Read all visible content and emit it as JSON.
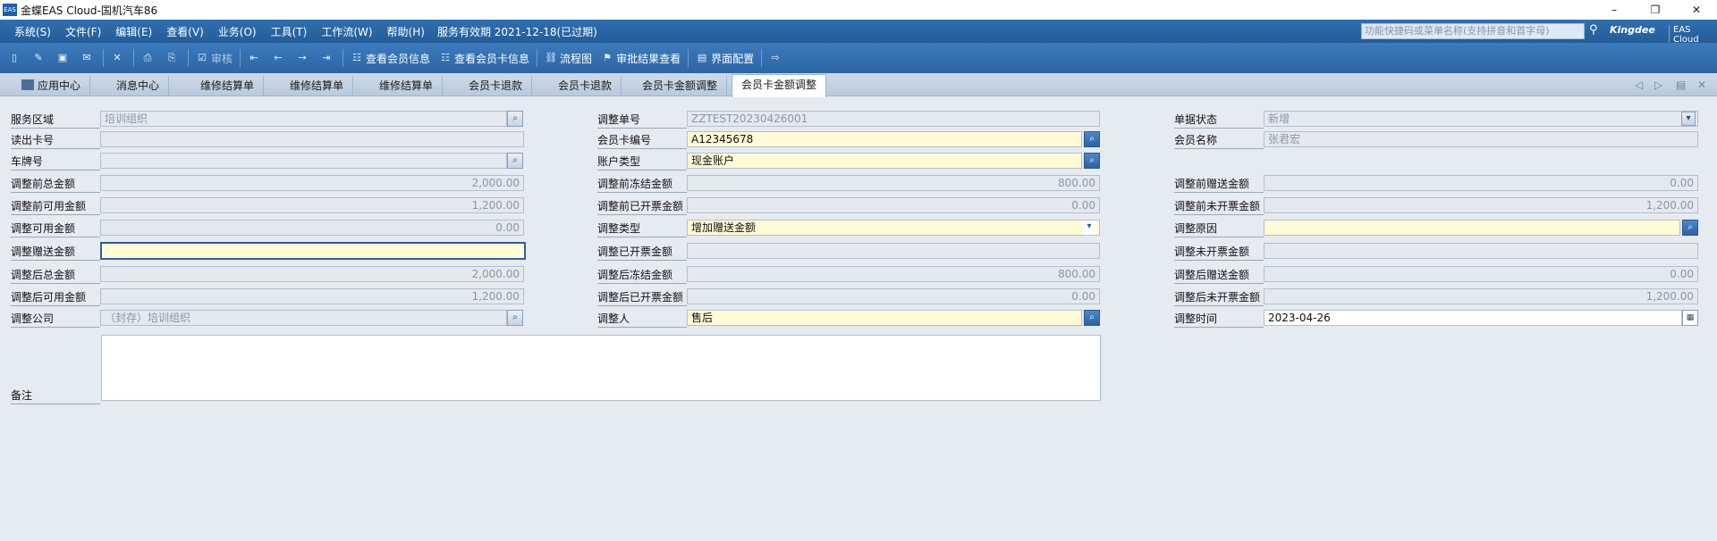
{
  "window": {
    "app_icon_text": "EAS",
    "title": "金蝶EAS Cloud-国机汽车86",
    "minimize": "–",
    "restore": "❐",
    "close": "✕"
  },
  "menubar": {
    "items": [
      "系统(S)",
      "文件(F)",
      "编辑(E)",
      "查看(V)",
      "业务(O)",
      "工具(T)",
      "工作流(W)",
      "帮助(H)"
    ],
    "service_status": "服务有效期 2021-12-18(已过期)",
    "quick_search_placeholder": "功能快捷码或菜单名称(支持拼音和首字母)",
    "brand": "Kingdee",
    "product": "EAS Cloud"
  },
  "toolbar": {
    "audit": "审核",
    "view_member_info": "查看会员信息",
    "view_member_card_info": "查看会员卡信息",
    "flowchart": "流程图",
    "approval_result": "审批结果查看",
    "ui_config": "界面配置"
  },
  "tabs": [
    "应用中心",
    "消息中心",
    "维修结算单",
    "维修结算单",
    "维修结算单",
    "会员卡退款",
    "会员卡退款",
    "会员卡金额调整",
    "会员卡金额调整"
  ],
  "form": {
    "col1": {
      "service_area": {
        "label": "服务区域",
        "value": "培训组织"
      },
      "read_card_no": {
        "label": "读出卡号",
        "value": ""
      },
      "plate_no": {
        "label": "车牌号",
        "value": ""
      },
      "before_total": {
        "label": "调整前总金额",
        "value": "2,000.00"
      },
      "before_available": {
        "label": "调整前可用金额",
        "value": "1,200.00"
      },
      "adjust_available": {
        "label": "调整可用金额",
        "value": "0.00"
      },
      "adjust_gift": {
        "label": "调整赠送金额",
        "value": ""
      },
      "after_total": {
        "label": "调整后总金额",
        "value": "2,000.00"
      },
      "after_available": {
        "label": "调整后可用金额",
        "value": "1,200.00"
      },
      "company": {
        "label": "调整公司",
        "value": "（封存）培训组织"
      },
      "remarks": {
        "label": "备注"
      }
    },
    "col2": {
      "doc_no": {
        "label": "调整单号",
        "value": "ZZTEST20230426001"
      },
      "card_no": {
        "label": "会员卡编号",
        "value": "A12345678"
      },
      "account_type": {
        "label": "账户类型",
        "value": "现金账户"
      },
      "before_frozen": {
        "label": "调整前冻结金额",
        "value": "800.00"
      },
      "before_invoiced": {
        "label": "调整前已开票金额",
        "value": "0.00"
      },
      "adjust_type": {
        "label": "调整类型",
        "value": "增加赠送金额"
      },
      "adjust_invoiced": {
        "label": "调整已开票金额",
        "value": ""
      },
      "after_frozen": {
        "label": "调整后冻结金额",
        "value": "800.00"
      },
      "after_invoiced": {
        "label": "调整后已开票金额",
        "value": "0.00"
      },
      "adjuster": {
        "label": "调整人",
        "value": "售后"
      }
    },
    "col3": {
      "status": {
        "label": "单据状态",
        "value": "新增"
      },
      "member_name": {
        "label": "会员名称",
        "value": "张君宏"
      },
      "before_gift": {
        "label": "调整前赠送金额",
        "value": "0.00"
      },
      "before_uninvoiced": {
        "label": "调整前未开票金额",
        "value": "1,200.00"
      },
      "reason": {
        "label": "调整原因",
        "value": ""
      },
      "adjust_uninvoiced": {
        "label": "调整未开票金额",
        "value": ""
      },
      "after_gift": {
        "label": "调整后赠送金额",
        "value": "0.00"
      },
      "after_uninvoiced": {
        "label": "调整后未开票金额",
        "value": "1,200.00"
      },
      "adjust_time": {
        "label": "调整时间",
        "value": "2023-04-26"
      }
    }
  }
}
